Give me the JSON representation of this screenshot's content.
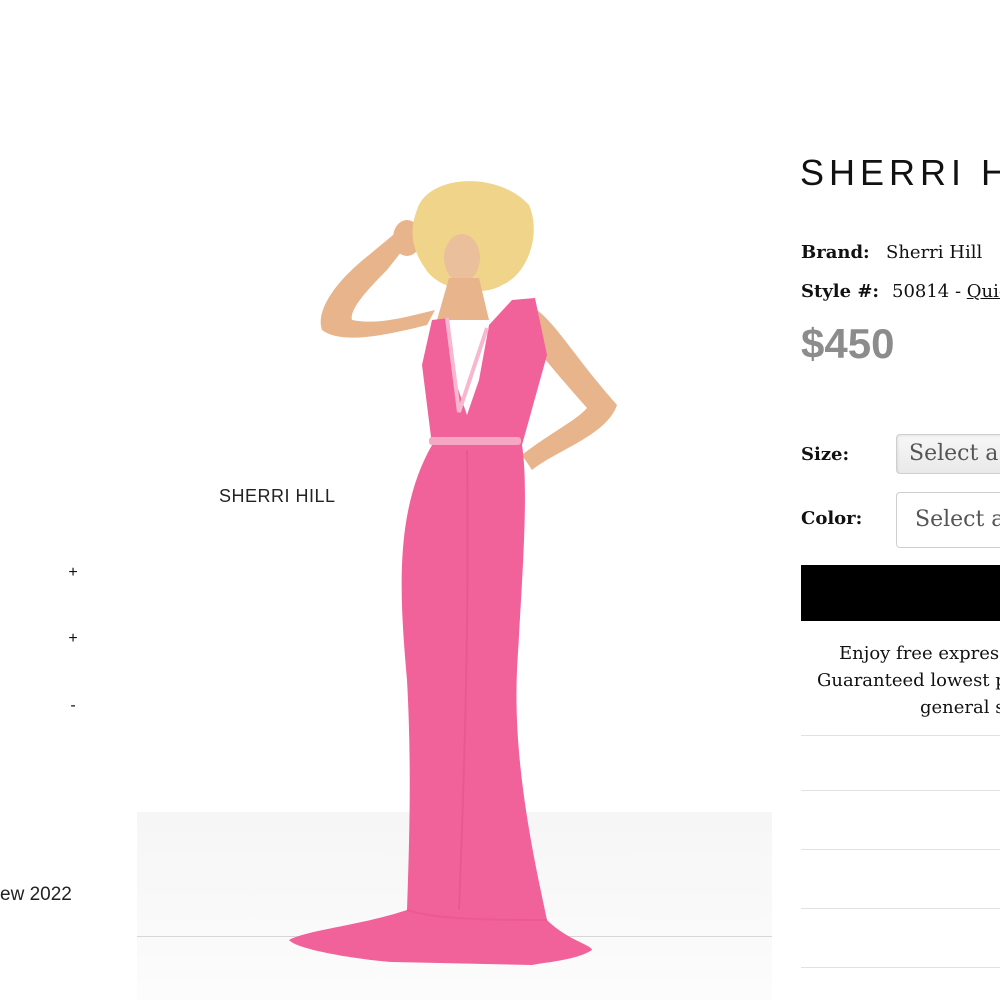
{
  "filters": {
    "toggles": [
      "+",
      "+",
      "-"
    ],
    "partial_text": "ew 2022"
  },
  "image": {
    "logo_text": "SHERRI HILL",
    "dress_color": "#f2629a"
  },
  "product": {
    "brand_heading": "SHERRI HILL",
    "brand_label": "Brand:",
    "brand_value": "Sherri Hill",
    "style_label": "Style #:",
    "style_value": "50814 - ",
    "quick_link": "Quic",
    "price": "$450"
  },
  "options": {
    "size_label": "Size:",
    "size_value": "Select a",
    "color_label": "Color:",
    "color_value": "Select a"
  },
  "promo": {
    "line1": "Enjoy free express",
    "line2": "Guaranteed lowest p",
    "line3": "general s"
  },
  "colors": {
    "price": "#8c8c8c",
    "button": "#000000"
  }
}
